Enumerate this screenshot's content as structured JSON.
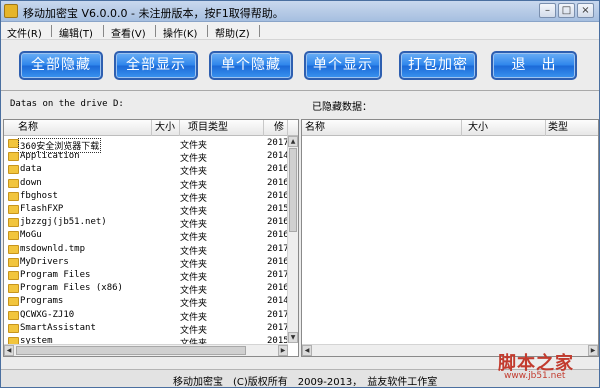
{
  "window": {
    "title": "移动加密宝 V6.0.0.0 - 未注册版本，按F1取得帮助。",
    "minimize_glyph": "–",
    "restore_glyph": "□",
    "close_glyph": "×"
  },
  "menu": {
    "items": [
      "文件(R)",
      "编辑(T)",
      "查看(V)",
      "操作(K)",
      "帮助(Z)"
    ]
  },
  "toolbar": {
    "buttons": [
      "全部隐藏",
      "全部显示",
      "单个隐藏",
      "单个显示",
      "打包加密",
      "退　出"
    ]
  },
  "left_panel": {
    "label": "Datas on the drive D:",
    "columns": [
      "名称",
      "大小",
      "项目类型",
      "修"
    ],
    "rows": [
      {
        "name": "360安全浏览器下载",
        "type": "文件夹",
        "date": "2017-"
      },
      {
        "name": "Application",
        "type": "文件夹",
        "date": "2014-"
      },
      {
        "name": "data",
        "type": "文件夹",
        "date": "2016-"
      },
      {
        "name": "down",
        "type": "文件夹",
        "date": "2016-"
      },
      {
        "name": "fbghost",
        "type": "文件夹",
        "date": "2016-"
      },
      {
        "name": "FlashFXP",
        "type": "文件夹",
        "date": "2015-"
      },
      {
        "name": "jbzzgj(jb51.net)",
        "type": "文件夹",
        "date": "2016-"
      },
      {
        "name": "MoGu",
        "type": "文件夹",
        "date": "2016-"
      },
      {
        "name": "msdownld.tmp",
        "type": "文件夹",
        "date": "2017-"
      },
      {
        "name": "MyDrivers",
        "type": "文件夹",
        "date": "2016-"
      },
      {
        "name": "Program Files",
        "type": "文件夹",
        "date": "2017-"
      },
      {
        "name": "Program Files (x86)",
        "type": "文件夹",
        "date": "2016-"
      },
      {
        "name": "Programs",
        "type": "文件夹",
        "date": "2014-"
      },
      {
        "name": "QCWXG-ZJ10",
        "type": "文件夹",
        "date": "2017-"
      },
      {
        "name": "SmartAssistant",
        "type": "文件夹",
        "date": "2017-"
      },
      {
        "name": "system",
        "type": "文件夹",
        "date": "2015-"
      }
    ],
    "selected_index": 0
  },
  "right_panel": {
    "label": "已隐藏数据：",
    "columns": [
      "名称",
      "大小",
      "类型"
    ]
  },
  "statusbar": {
    "text": "移动加密宝　(C)版权所有　2009-2013，　益友软件工作室"
  },
  "watermark": {
    "main": "脚本之家",
    "url": "www.jb51.net"
  }
}
